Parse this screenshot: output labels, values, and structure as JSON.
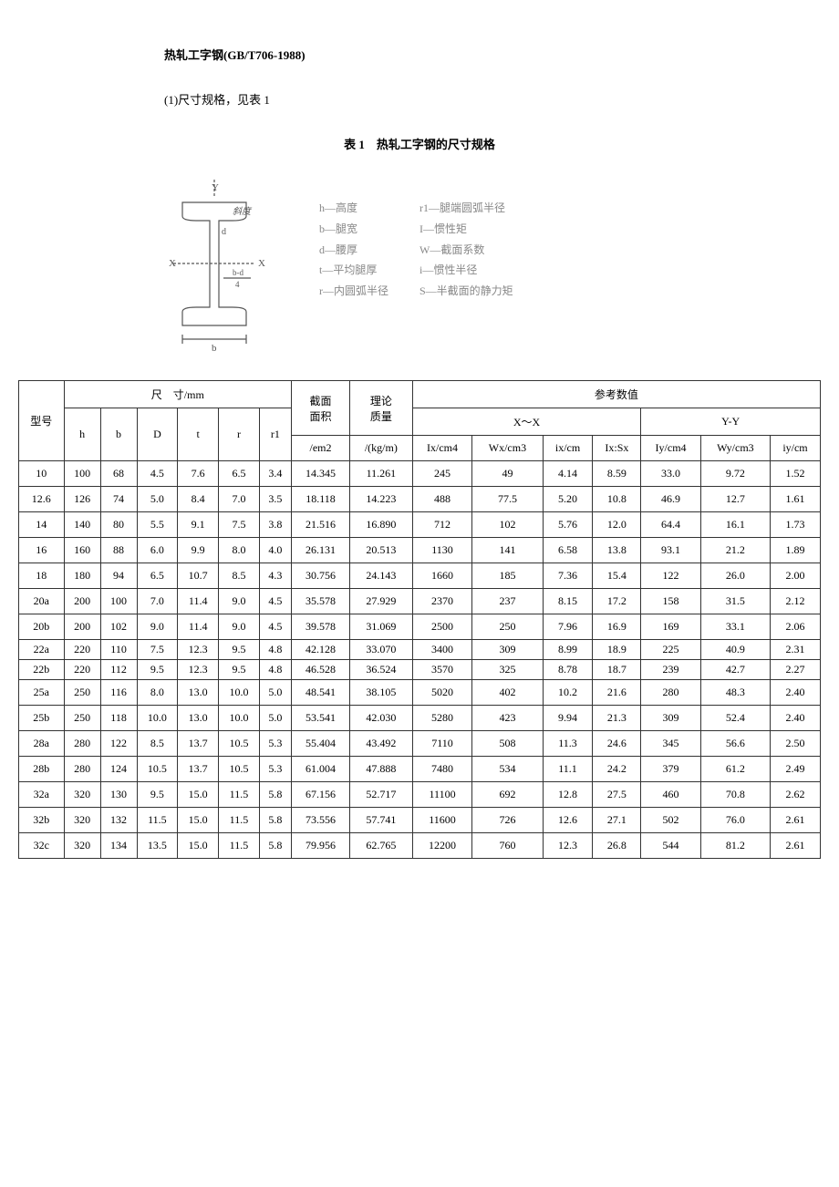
{
  "doc_title": "热轧工字钢(GB/T706-1988)",
  "note": "(1)尺寸规格，见表 1",
  "table_caption": "表 1　热轧工字钢的尺寸规格",
  "legend": {
    "left": [
      "h—高度",
      "b—腿宽",
      "d—腰厚",
      "t—平均腿厚",
      "r—内圆弧半径"
    ],
    "right": [
      "r1—腿端圆弧半径",
      "I—惯性矩",
      "W—截面系数",
      "i—惯性半径",
      "S—半截面的静力矩"
    ]
  },
  "columns": {
    "model": "型号",
    "dim_group": "尺　寸/mm",
    "dims": [
      "h",
      "b",
      "D",
      "t",
      "r",
      "r1"
    ],
    "area_l1": "截面",
    "area_l2": "面积",
    "area_l3": "/em2",
    "mass_l1": "理论",
    "mass_l2": "质量",
    "mass_l3": "/(kg/m)",
    "ref_group": "参考数值",
    "xx_group": "X～X",
    "yy_group": "Y-Y",
    "xx": [
      "Ix/cm4",
      "Wx/cm3",
      "ix/cm",
      "Ix:Sx"
    ],
    "yy": [
      "Iy/cm4",
      "Wy/cm3",
      "iy/cm"
    ]
  },
  "rows": [
    {
      "model": "10",
      "h": "100",
      "b": "68",
      "d": "4.5",
      "t": "7.6",
      "r": "6.5",
      "r1": "3.4",
      "area": "14.345",
      "mass": "11.261",
      "ix": "245",
      "wx": "49",
      "rix": "4.14",
      "sx": "8.59",
      "iy": "33.0",
      "wy": "9.72",
      "riy": "1.52",
      "tight": false
    },
    {
      "model": "12.6",
      "h": "126",
      "b": "74",
      "d": "5.0",
      "t": "8.4",
      "r": "7.0",
      "r1": "3.5",
      "area": "18.118",
      "mass": "14.223",
      "ix": "488",
      "wx": "77.5",
      "rix": "5.20",
      "sx": "10.8",
      "iy": "46.9",
      "wy": "12.7",
      "riy": "1.61",
      "tight": false
    },
    {
      "model": "14",
      "h": "140",
      "b": "80",
      "d": "5.5",
      "t": "9.1",
      "r": "7.5",
      "r1": "3.8",
      "area": "21.516",
      "mass": "16.890",
      "ix": "712",
      "wx": "102",
      "rix": "5.76",
      "sx": "12.0",
      "iy": "64.4",
      "wy": "16.1",
      "riy": "1.73",
      "tight": false
    },
    {
      "model": "16",
      "h": "160",
      "b": "88",
      "d": "6.0",
      "t": "9.9",
      "r": "8.0",
      "r1": "4.0",
      "area": "26.131",
      "mass": "20.513",
      "ix": "1130",
      "wx": "141",
      "rix": "6.58",
      "sx": "13.8",
      "iy": "93.1",
      "wy": "21.2",
      "riy": "1.89",
      "tight": false
    },
    {
      "model": "18",
      "h": "180",
      "b": "94",
      "d": "6.5",
      "t": "10.7",
      "r": "8.5",
      "r1": "4.3",
      "area": "30.756",
      "mass": "24.143",
      "ix": "1660",
      "wx": "185",
      "rix": "7.36",
      "sx": "15.4",
      "iy": "122",
      "wy": "26.0",
      "riy": "2.00",
      "tight": false
    },
    {
      "model": "20a",
      "h": "200",
      "b": "100",
      "d": "7.0",
      "t": "11.4",
      "r": "9.0",
      "r1": "4.5",
      "area": "35.578",
      "mass": "27.929",
      "ix": "2370",
      "wx": "237",
      "rix": "8.15",
      "sx": "17.2",
      "iy": "158",
      "wy": "31.5",
      "riy": "2.12",
      "tight": false
    },
    {
      "model": "20b",
      "h": "200",
      "b": "102",
      "d": "9.0",
      "t": "11.4",
      "r": "9.0",
      "r1": "4.5",
      "area": "39.578",
      "mass": "31.069",
      "ix": "2500",
      "wx": "250",
      "rix": "7.96",
      "sx": "16.9",
      "iy": "169",
      "wy": "33.1",
      "riy": "2.06",
      "tight": false
    },
    {
      "model": "22a",
      "h": "220",
      "b": "110",
      "d": "7.5",
      "t": "12.3",
      "r": "9.5",
      "r1": "4.8",
      "area": "42.128",
      "mass": "33.070",
      "ix": "3400",
      "wx": "309",
      "rix": "8.99",
      "sx": "18.9",
      "iy": "225",
      "wy": "40.9",
      "riy": "2.31",
      "tight": true
    },
    {
      "model": "22b",
      "h": "220",
      "b": "112",
      "d": "9.5",
      "t": "12.3",
      "r": "9.5",
      "r1": "4.8",
      "area": "46.528",
      "mass": "36.524",
      "ix": "3570",
      "wx": "325",
      "rix": "8.78",
      "sx": "18.7",
      "iy": "239",
      "wy": "42.7",
      "riy": "2.27",
      "tight": true
    },
    {
      "model": "25a",
      "h": "250",
      "b": "116",
      "d": "8.0",
      "t": "13.0",
      "r": "10.0",
      "r1": "5.0",
      "area": "48.541",
      "mass": "38.105",
      "ix": "5020",
      "wx": "402",
      "rix": "10.2",
      "sx": "21.6",
      "iy": "280",
      "wy": "48.3",
      "riy": "2.40",
      "tight": false
    },
    {
      "model": "25b",
      "h": "250",
      "b": "118",
      "d": "10.0",
      "t": "13.0",
      "r": "10.0",
      "r1": "5.0",
      "area": "53.541",
      "mass": "42.030",
      "ix": "5280",
      "wx": "423",
      "rix": "9.94",
      "sx": "21.3",
      "iy": "309",
      "wy": "52.4",
      "riy": "2.40",
      "tight": false
    },
    {
      "model": "28a",
      "h": "280",
      "b": "122",
      "d": "8.5",
      "t": "13.7",
      "r": "10.5",
      "r1": "5.3",
      "area": "55.404",
      "mass": "43.492",
      "ix": "7110",
      "wx": "508",
      "rix": "11.3",
      "sx": "24.6",
      "iy": "345",
      "wy": "56.6",
      "riy": "2.50",
      "tight": false
    },
    {
      "model": "28b",
      "h": "280",
      "b": "124",
      "d": "10.5",
      "t": "13.7",
      "r": "10.5",
      "r1": "5.3",
      "area": "61.004",
      "mass": "47.888",
      "ix": "7480",
      "wx": "534",
      "rix": "11.1",
      "sx": "24.2",
      "iy": "379",
      "wy": "61.2",
      "riy": "2.49",
      "tight": false
    },
    {
      "model": "32a",
      "h": "320",
      "b": "130",
      "d": "9.5",
      "t": "15.0",
      "r": "11.5",
      "r1": "5.8",
      "area": "67.156",
      "mass": "52.717",
      "ix": "11100",
      "wx": "692",
      "rix": "12.8",
      "sx": "27.5",
      "iy": "460",
      "wy": "70.8",
      "riy": "2.62",
      "tight": false
    },
    {
      "model": "32b",
      "h": "320",
      "b": "132",
      "d": "11.5",
      "t": "15.0",
      "r": "11.5",
      "r1": "5.8",
      "area": "73.556",
      "mass": "57.741",
      "ix": "11600",
      "wx": "726",
      "rix": "12.6",
      "sx": "27.1",
      "iy": "502",
      "wy": "76.0",
      "riy": "2.61",
      "tight": false
    },
    {
      "model": "32c",
      "h": "320",
      "b": "134",
      "d": "13.5",
      "t": "15.0",
      "r": "11.5",
      "r1": "5.8",
      "area": "79.956",
      "mass": "62.765",
      "ix": "12200",
      "wx": "760",
      "rix": "12.3",
      "sx": "26.8",
      "iy": "544",
      "wy": "81.2",
      "riy": "2.61",
      "tight": false
    }
  ]
}
